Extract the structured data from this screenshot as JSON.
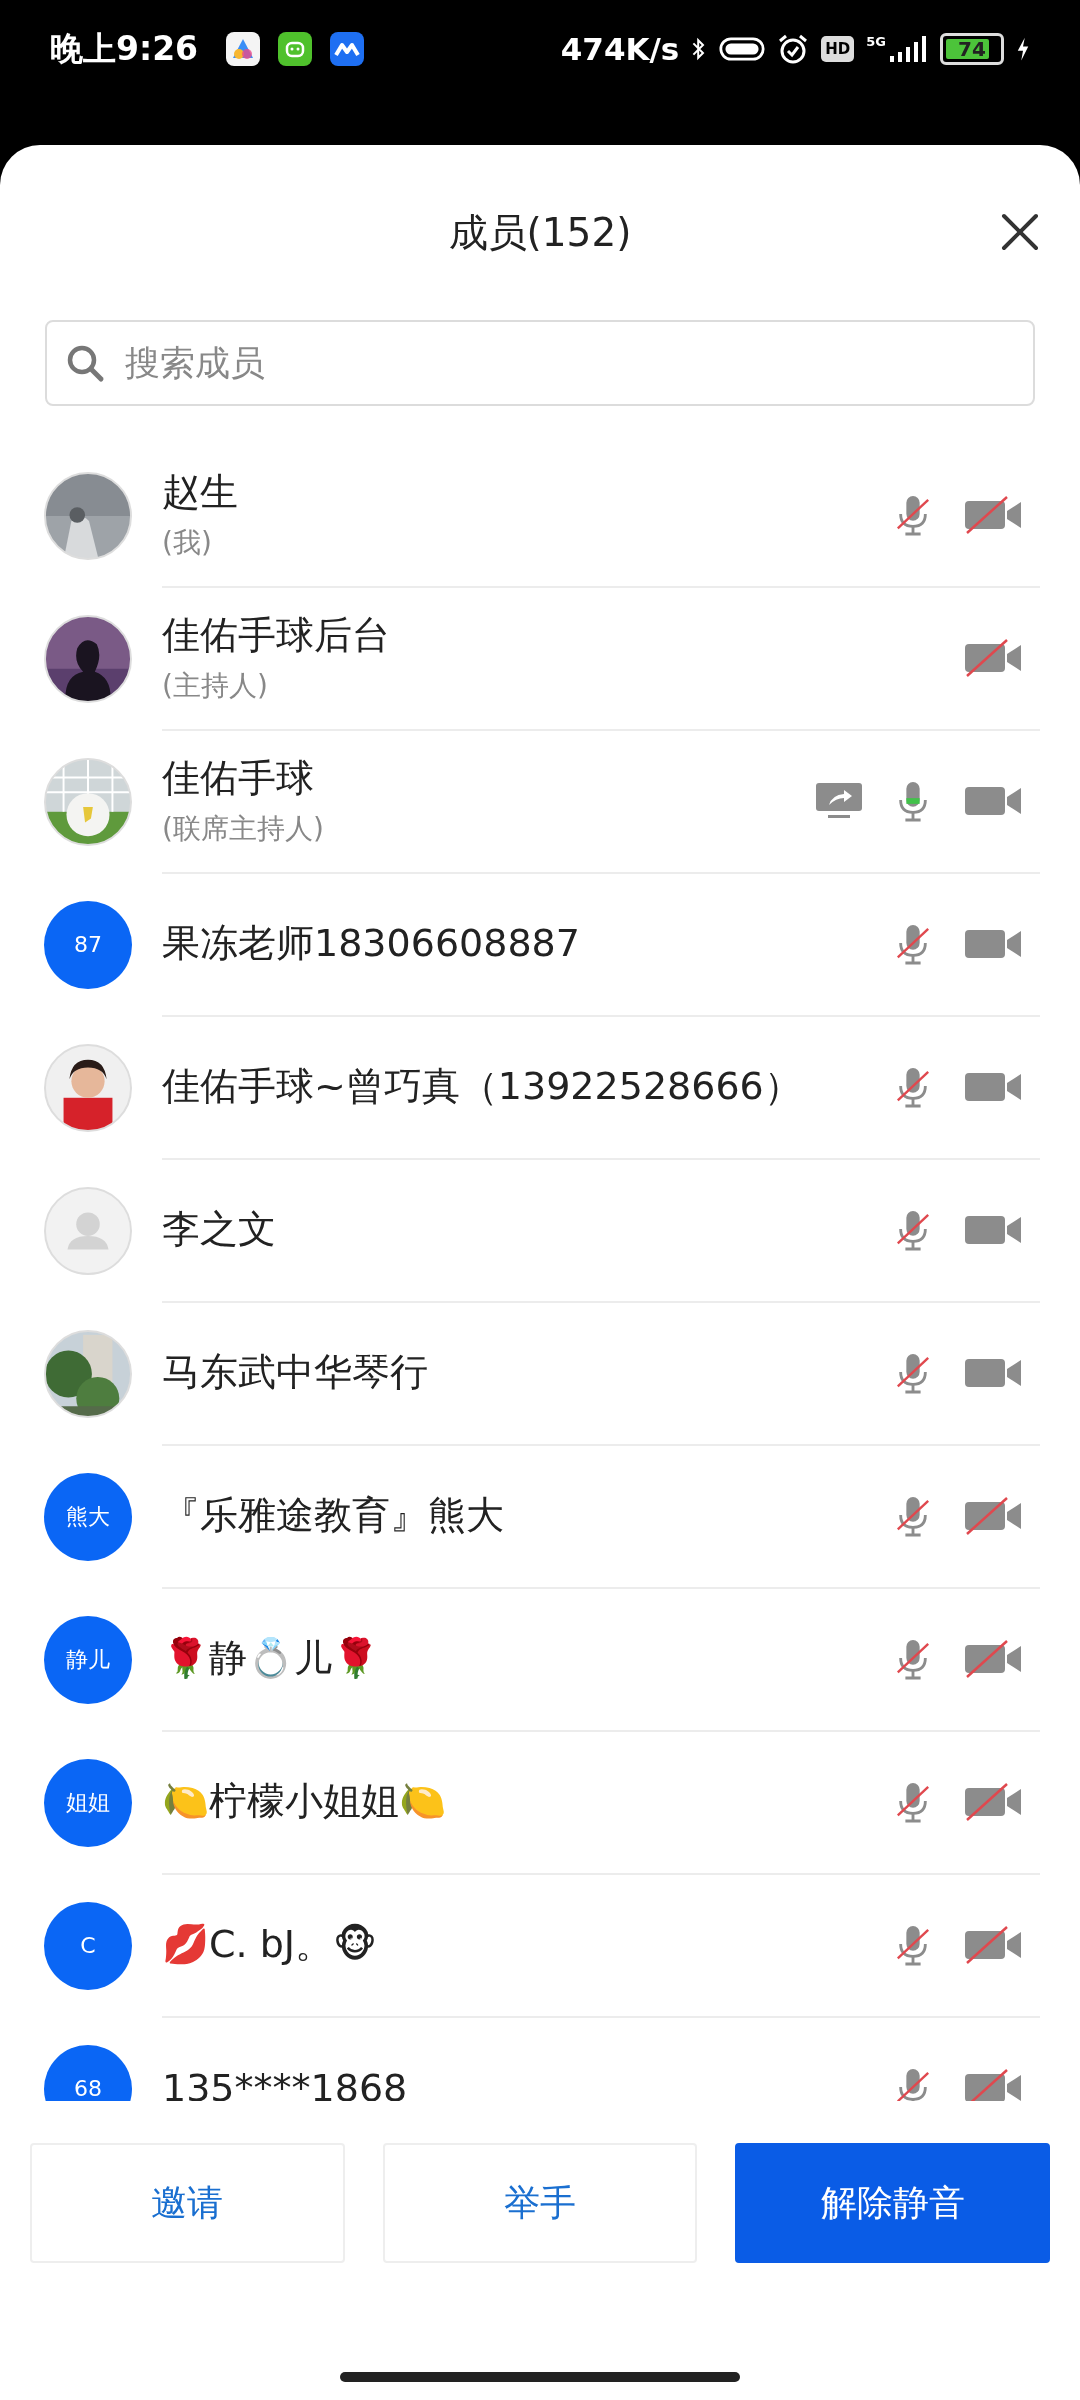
{
  "status_bar": {
    "time": "晚上9:26",
    "speed": "474K/s",
    "hd": "HD",
    "network": "5G",
    "battery": "74"
  },
  "header": {
    "title": "成员(152)"
  },
  "search": {
    "placeholder": "搜索成员"
  },
  "members": [
    {
      "name": "赵生",
      "role": "(我)",
      "mic_hidden": false,
      "mic_muted": true,
      "video_off": true,
      "sharing": false
    },
    {
      "name": "佳佑手球后台",
      "role": "(主持人)",
      "mic_hidden": true,
      "video_off": true,
      "sharing": false
    },
    {
      "name": "佳佑手球",
      "role": "(联席主持人)",
      "mic_hidden": false,
      "mic_muted": false,
      "video_off": false,
      "sharing": true
    },
    {
      "name": "果冻老师18306608887",
      "avatar": {
        "kind": "initials",
        "text": "87"
      },
      "mic_hidden": false,
      "mic_muted": true,
      "video_off": false,
      "sharing": false
    },
    {
      "name": "佳佑手球~曾巧真（13922528666）",
      "mic_hidden": false,
      "mic_muted": true,
      "video_off": false,
      "sharing": false
    },
    {
      "name": "李之文",
      "avatar": {
        "kind": "default"
      },
      "mic_hidden": false,
      "mic_muted": true,
      "video_off": false,
      "sharing": false
    },
    {
      "name": "马东武中华琴行",
      "mic_hidden": false,
      "mic_muted": true,
      "video_off": false,
      "sharing": false
    },
    {
      "name": "『乐雅途教育』熊大",
      "avatar": {
        "kind": "initials",
        "text": "熊大"
      },
      "mic_hidden": false,
      "mic_muted": true,
      "video_off": true,
      "sharing": false
    },
    {
      "name": "🌹静💍儿🌹",
      "avatar": {
        "kind": "initials",
        "text": "静儿"
      },
      "mic_hidden": false,
      "mic_muted": true,
      "video_off": true,
      "sharing": false
    },
    {
      "name": "🍋柠檬小姐姐🍋",
      "avatar": {
        "kind": "initials",
        "text": "姐姐"
      },
      "mic_hidden": false,
      "mic_muted": true,
      "video_off": true,
      "sharing": false
    },
    {
      "name": "💋C. bJ。🐵",
      "avatar": {
        "kind": "initials",
        "text": "C"
      },
      "mic_hidden": false,
      "mic_muted": true,
      "video_off": true,
      "sharing": false
    },
    {
      "name": "135****1868",
      "avatar": {
        "kind": "initials",
        "text": "68"
      },
      "mic_hidden": false,
      "mic_muted": true,
      "video_off": true,
      "sharing": false
    }
  ],
  "buttons": [
    {
      "label": "邀请",
      "primary": false
    },
    {
      "label": "举手",
      "primary": false
    },
    {
      "label": "解除静音",
      "primary": true
    }
  ]
}
